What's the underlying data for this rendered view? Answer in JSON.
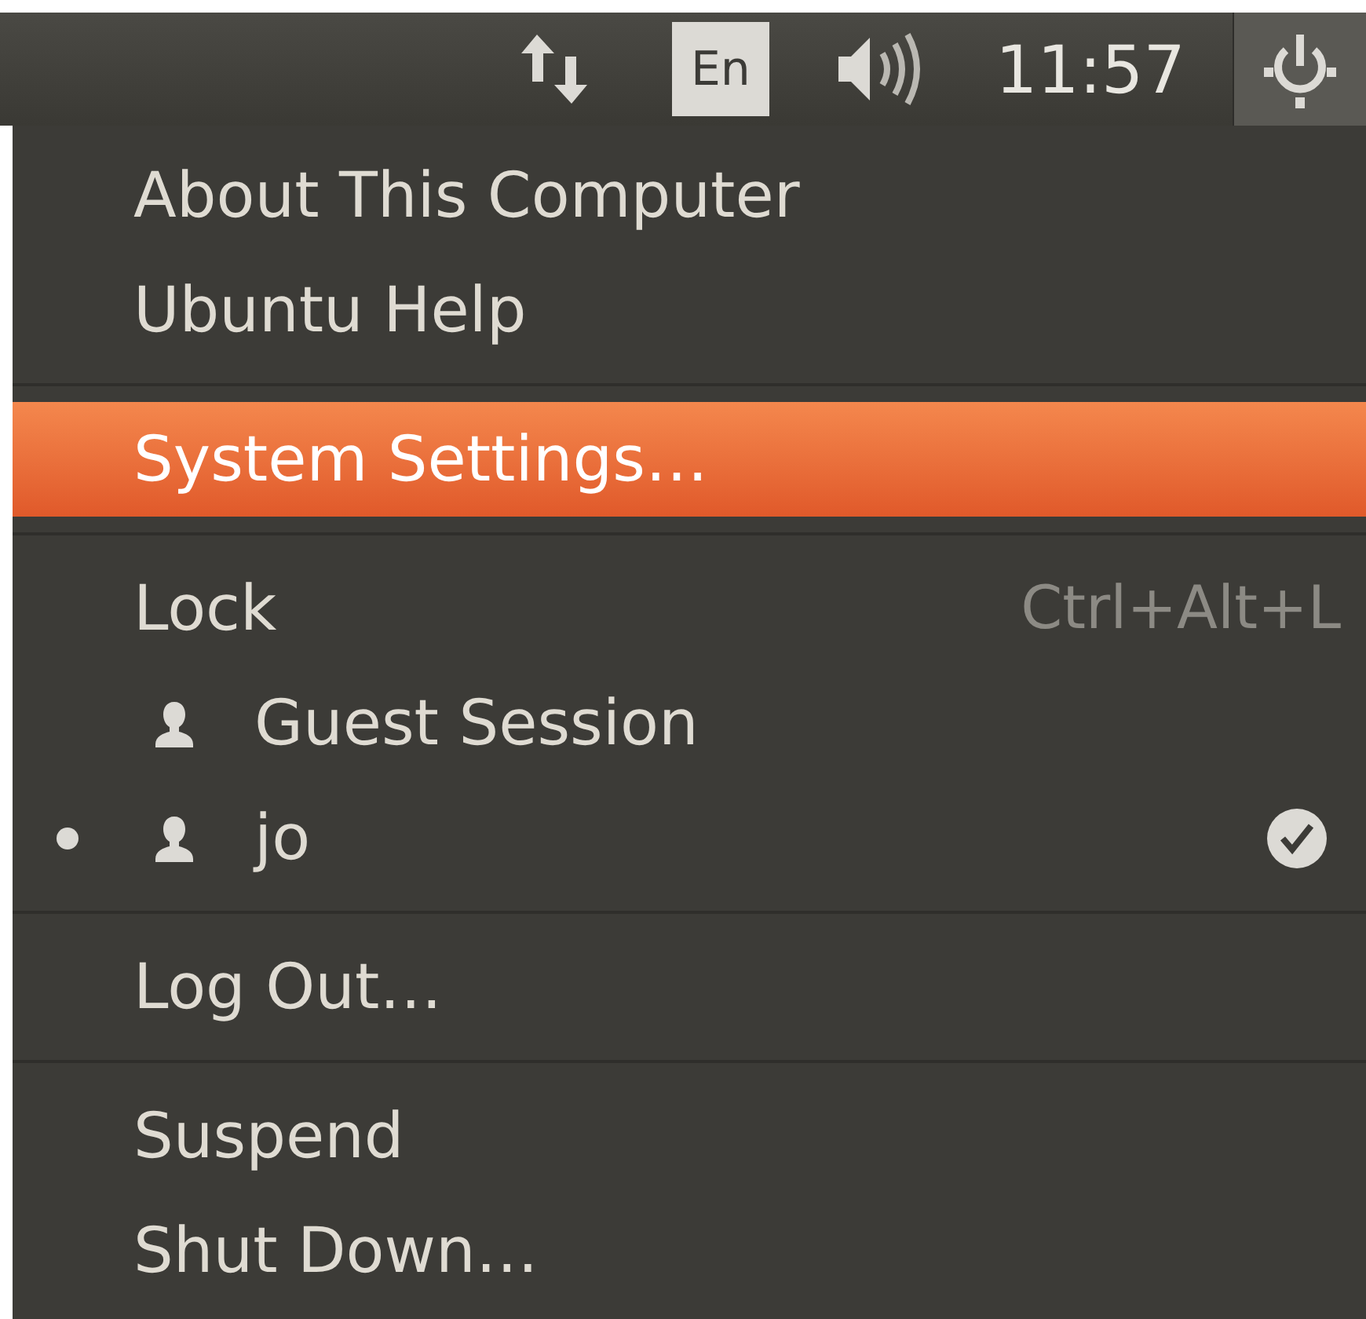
{
  "panel": {
    "keyboard_layout": "En",
    "time": "11:57"
  },
  "menu": [
    {
      "kind": "item",
      "label": "About This Computer",
      "selected": false
    },
    {
      "kind": "item",
      "label": "Ubuntu Help",
      "selected": false
    },
    {
      "kind": "separator"
    },
    {
      "kind": "item",
      "label": "System Settings…",
      "selected": true
    },
    {
      "kind": "separator"
    },
    {
      "kind": "item",
      "label": "Lock",
      "shortcut": "Ctrl+Alt+L",
      "selected": false
    },
    {
      "kind": "user",
      "label": "Guest Session",
      "current": false,
      "checked": false,
      "selected": false
    },
    {
      "kind": "user",
      "label": "jo",
      "current": true,
      "checked": true,
      "selected": false
    },
    {
      "kind": "separator"
    },
    {
      "kind": "item",
      "label": "Log Out…",
      "selected": false
    },
    {
      "kind": "separator"
    },
    {
      "kind": "item",
      "label": "Suspend",
      "selected": false
    },
    {
      "kind": "item",
      "label": "Shut Down…",
      "selected": false
    }
  ]
}
